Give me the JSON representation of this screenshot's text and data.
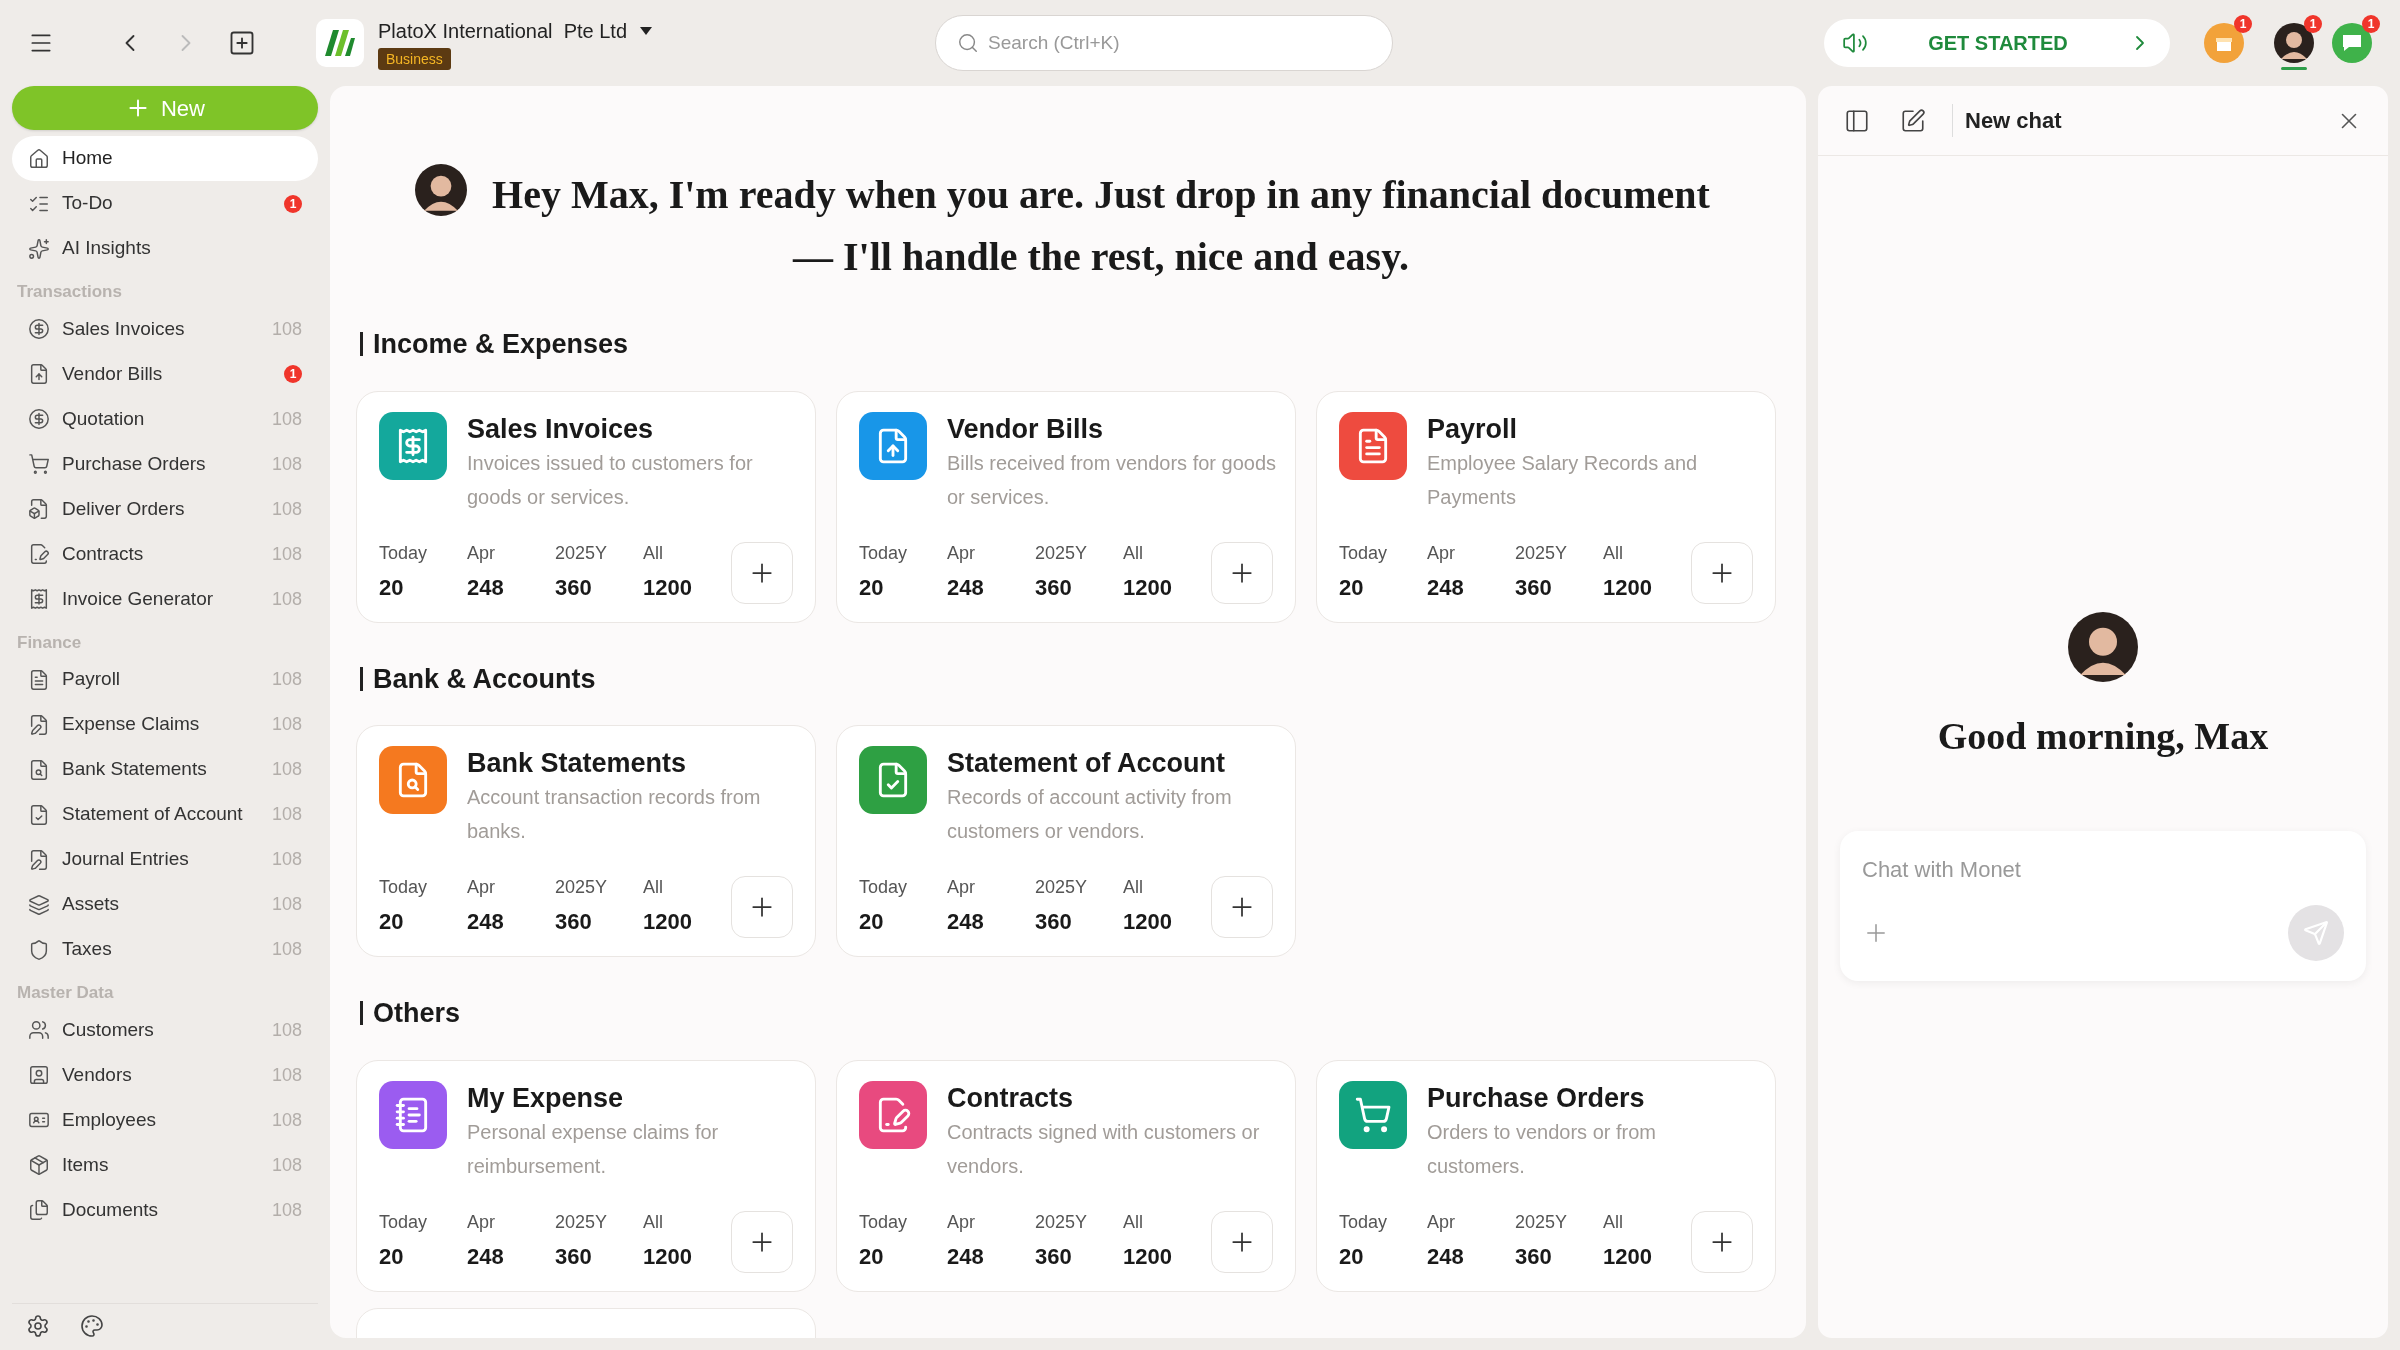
{
  "topbar": {
    "company": "PlatoX International  Pte Ltd",
    "plan_badge": "Business",
    "search_placeholder": "Search (Ctrl+K)",
    "get_started": "GET STARTED",
    "notification_badges": [
      "1",
      "1",
      "1"
    ]
  },
  "sidebar": {
    "new_button": "New",
    "nav": [
      {
        "label": "Home",
        "selected": true
      },
      {
        "label": "To-Do",
        "selected": false,
        "badge": "1"
      },
      {
        "label": "AI Insights",
        "selected": false
      }
    ],
    "groups": [
      {
        "title": "Transactions",
        "items": [
          {
            "label": "Sales Invoices",
            "count": "108"
          },
          {
            "label": "Vendor Bills",
            "badge": "1"
          },
          {
            "label": "Quotation",
            "count": "108"
          },
          {
            "label": "Purchase Orders",
            "count": "108"
          },
          {
            "label": "Deliver Orders",
            "count": "108"
          },
          {
            "label": "Contracts",
            "count": "108"
          },
          {
            "label": "Invoice Generator",
            "count": "108"
          }
        ]
      },
      {
        "title": "Finance",
        "items": [
          {
            "label": "Payroll",
            "count": "108"
          },
          {
            "label": "Expense Claims",
            "count": "108"
          },
          {
            "label": "Bank Statements",
            "count": "108"
          },
          {
            "label": "Statement  of Account",
            "count": "108"
          },
          {
            "label": "Journal Entries",
            "count": "108"
          },
          {
            "label": "Assets",
            "count": "108"
          },
          {
            "label": "Taxes",
            "count": "108"
          }
        ]
      },
      {
        "title": "Master Data",
        "items": [
          {
            "label": "Customers",
            "count": "108"
          },
          {
            "label": "Vendors",
            "count": "108"
          },
          {
            "label": "Employees",
            "count": "108"
          },
          {
            "label": "Items",
            "count": "108"
          },
          {
            "label": "Documents",
            "count": "108"
          }
        ]
      }
    ]
  },
  "main": {
    "greeting": "Hey Max, I'm ready when you are. Just drop in any financial document — I'll handle the rest, nice and easy.",
    "sections": [
      {
        "title": "Income & Expenses",
        "cards": [
          {
            "title": "Sales Invoices",
            "description": "Invoices issued to customers for goods or services.",
            "color": "#14a89c",
            "stats": [
              {
                "label": "Today",
                "value": "20"
              },
              {
                "label": "Apr",
                "value": "248"
              },
              {
                "label": "2025Y",
                "value": "360"
              },
              {
                "label": "All",
                "value": "1200"
              }
            ]
          },
          {
            "title": "Vendor Bills",
            "description": "Bills received from vendors for goods or services.",
            "color": "#1896e8",
            "stats": [
              {
                "label": "Today",
                "value": "20"
              },
              {
                "label": "Apr",
                "value": "248"
              },
              {
                "label": "2025Y",
                "value": "360"
              },
              {
                "label": "All",
                "value": "1200"
              }
            ]
          },
          {
            "title": "Payroll",
            "description": "Employee Salary Records and Payments",
            "color": "#ee4b3f",
            "stats": [
              {
                "label": "Today",
                "value": "20"
              },
              {
                "label": "Apr",
                "value": "248"
              },
              {
                "label": "2025Y",
                "value": "360"
              },
              {
                "label": "All",
                "value": "1200"
              }
            ]
          }
        ]
      },
      {
        "title": "Bank & Accounts",
        "cards": [
          {
            "title": "Bank Statements",
            "description": "Account transaction records from banks.",
            "color": "#f5791f",
            "stats": [
              {
                "label": "Today",
                "value": "20"
              },
              {
                "label": "Apr",
                "value": "248"
              },
              {
                "label": "2025Y",
                "value": "360"
              },
              {
                "label": "All",
                "value": "1200"
              }
            ]
          },
          {
            "title": "Statement of Account",
            "description": "Records of account activity from customers or vendors.",
            "color": "#2ea043",
            "stats": [
              {
                "label": "Today",
                "value": "20"
              },
              {
                "label": "Apr",
                "value": "248"
              },
              {
                "label": "2025Y",
                "value": "360"
              },
              {
                "label": "All",
                "value": "1200"
              }
            ]
          }
        ]
      },
      {
        "title": "Others",
        "cards": [
          {
            "title": "My Expense",
            "description": "Personal expense claims for reimbursement.",
            "color": "#9b5cf0",
            "stats": [
              {
                "label": "Today",
                "value": "20"
              },
              {
                "label": "Apr",
                "value": "248"
              },
              {
                "label": "2025Y",
                "value": "360"
              },
              {
                "label": "All",
                "value": "1200"
              }
            ]
          },
          {
            "title": "Contracts",
            "description": "Contracts signed with customers or vendors.",
            "color": "#e84a7f",
            "stats": [
              {
                "label": "Today",
                "value": "20"
              },
              {
                "label": "Apr",
                "value": "248"
              },
              {
                "label": "2025Y",
                "value": "360"
              },
              {
                "label": "All",
                "value": "1200"
              }
            ]
          },
          {
            "title": "Purchase Orders",
            "description": "Orders to vendors or from customers.",
            "color": "#12a37f",
            "stats": [
              {
                "label": "Today",
                "value": "20"
              },
              {
                "label": "Apr",
                "value": "248"
              },
              {
                "label": "2025Y",
                "value": "360"
              },
              {
                "label": "All",
                "value": "1200"
              }
            ]
          }
        ]
      }
    ]
  },
  "chat": {
    "title": "New chat",
    "greeting": "Good morning, Max",
    "placeholder": "Chat with Monet"
  }
}
